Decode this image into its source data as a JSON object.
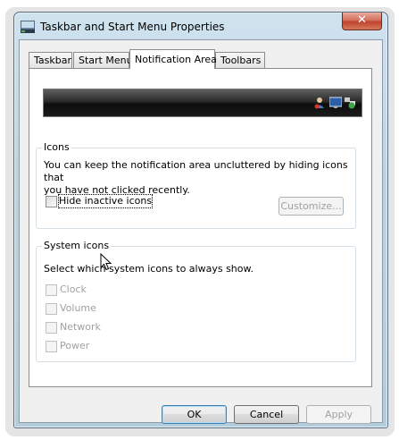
{
  "window": {
    "title": "Taskbar and Start Menu Properties",
    "close_label": "✕"
  },
  "tabs": [
    {
      "label": "Taskbar",
      "active": false
    },
    {
      "label": "Start Menu",
      "active": false
    },
    {
      "label": "Notification Area",
      "active": true
    },
    {
      "label": "Toolbars",
      "active": false
    }
  ],
  "icons_group": {
    "legend": "Icons",
    "description_line1": "You can keep the notification area uncluttered by hiding icons that",
    "description_line2": "you have not clicked recently.",
    "hide_inactive_label": "Hide inactive icons",
    "hide_inactive_checked": false,
    "customize_label": "Customize..."
  },
  "system_icons_group": {
    "legend": "System icons",
    "description": "Select which system icons to always show.",
    "items": [
      {
        "label": "Clock",
        "checked": false,
        "enabled": false
      },
      {
        "label": "Volume",
        "checked": false,
        "enabled": false
      },
      {
        "label": "Network",
        "checked": false,
        "enabled": false
      },
      {
        "label": "Power",
        "checked": false,
        "enabled": false
      }
    ]
  },
  "buttons": {
    "ok": "OK",
    "cancel": "Cancel",
    "apply": "Apply"
  },
  "colors": {
    "accent": "#3c7fb1",
    "close_button": "#c0432e",
    "taskbar_preview": "#1b1b1b"
  }
}
